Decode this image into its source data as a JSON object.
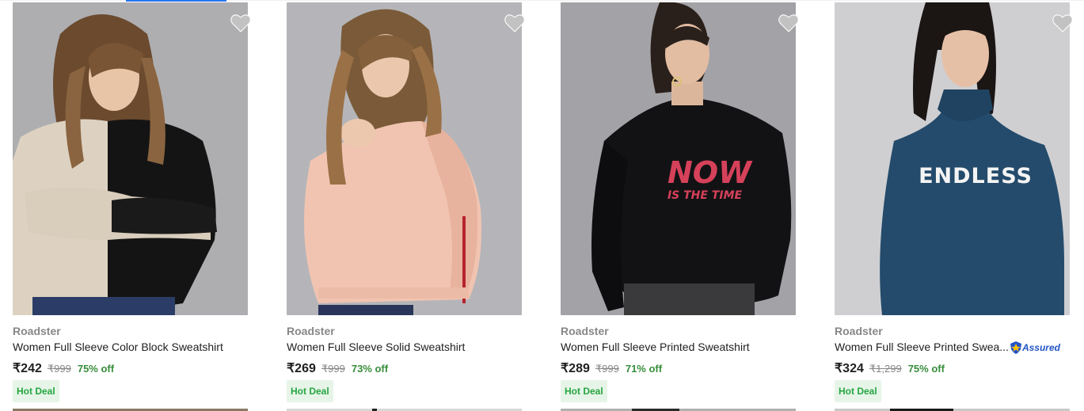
{
  "products": [
    {
      "brand": "Roadster",
      "title": "Women Full Sleeve Color Block Sweatshirt",
      "price": "₹242",
      "mrp": "₹999",
      "discount": "75% off",
      "deal": "Hot Deal",
      "assured": "",
      "image": "woman-color-block-sweatshirt"
    },
    {
      "brand": "Roadster",
      "title": "Women Full Sleeve Solid Sweatshirt",
      "price": "₹269",
      "mrp": "₹999",
      "discount": "73% off",
      "deal": "Hot Deal",
      "assured": "",
      "image": "woman-peach-sweatshirt"
    },
    {
      "brand": "Roadster",
      "title": "Women Full Sleeve Printed Sweatshirt",
      "price": "₹289",
      "mrp": "₹999",
      "discount": "71% off",
      "deal": "Hot Deal",
      "assured": "",
      "image": "woman-black-printed-sweatshirt",
      "print_text_1": "NOW",
      "print_text_2": "IS THE TIME"
    },
    {
      "brand": "Roadster",
      "title": "Women Full Sleeve Printed Swea...",
      "price": "₹324",
      "mrp": "₹1,299",
      "discount": "75% off",
      "deal": "Hot Deal",
      "assured": "Assured",
      "image": "woman-blue-printed-sweatshirt",
      "print_text_1": "ENDLESS"
    }
  ],
  "icons": {
    "wishlist": "heart-icon",
    "assured": "assured-badge-icon"
  },
  "colors": {
    "discount": "#388e3c",
    "deal_bg": "#e6f5e8",
    "deal_text": "#26a541",
    "brand_text": "#878787",
    "accent": "#2874f0",
    "assured": "#2455c7"
  }
}
